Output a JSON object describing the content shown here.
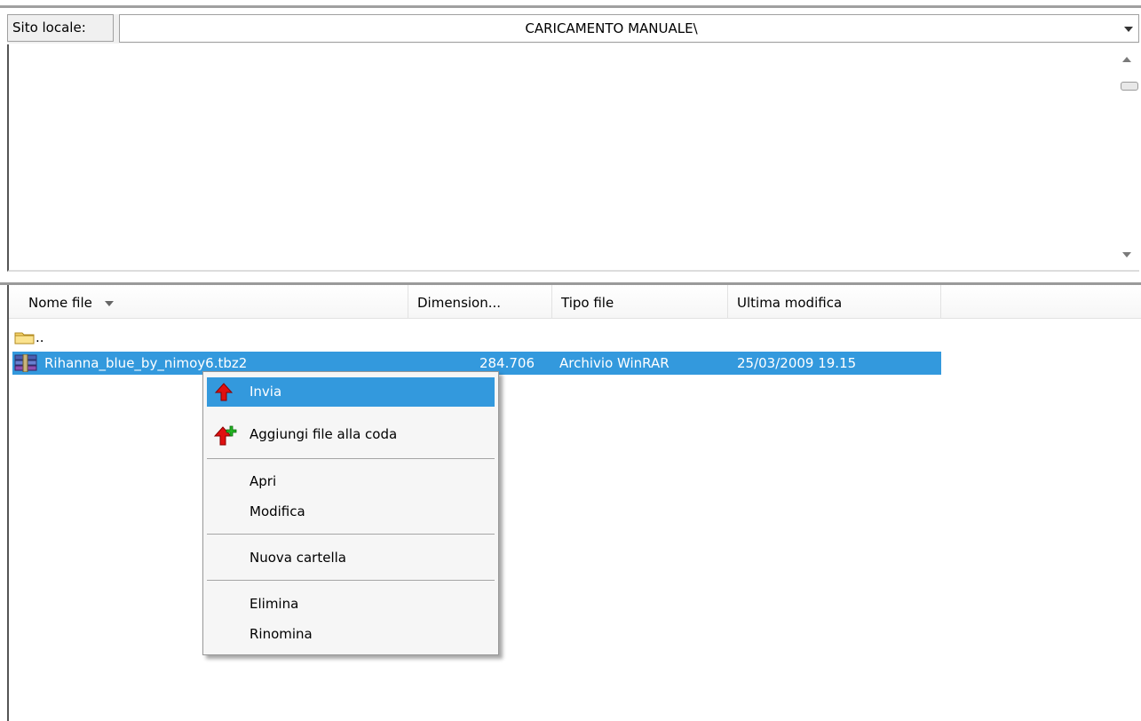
{
  "path_bar": {
    "label": "Sito locale:",
    "value": "CARICAMENTO MANUALE\\"
  },
  "columns": {
    "name": "Nome file",
    "size": "Dimension...",
    "type": "Tipo file",
    "modified": "Ultima modifica"
  },
  "files": [
    {
      "name": "..",
      "size": "",
      "type": "",
      "modified": ""
    },
    {
      "name": "Rihanna_blue_by_nimoy6.tbz2",
      "size": "284.706",
      "type": "Archivio WinRAR",
      "modified": "25/03/2009 19.15"
    }
  ],
  "context_menu": {
    "send": "Invia",
    "add_queue": "Aggiungi file alla coda",
    "open": "Apri",
    "edit": "Modifica",
    "new_folder": "Nuova cartella",
    "delete": "Elimina",
    "rename": "Rinomina"
  },
  "colors": {
    "selection": "#3399dd",
    "menu_bg": "#f6f6f6"
  },
  "icons": [
    "folder-icon",
    "winrar-archive-icon",
    "upload-arrow-icon",
    "add-to-queue-icon",
    "chevron-down-icon",
    "scroll-up-icon",
    "scroll-down-icon",
    "sort-indicator-icon"
  ]
}
